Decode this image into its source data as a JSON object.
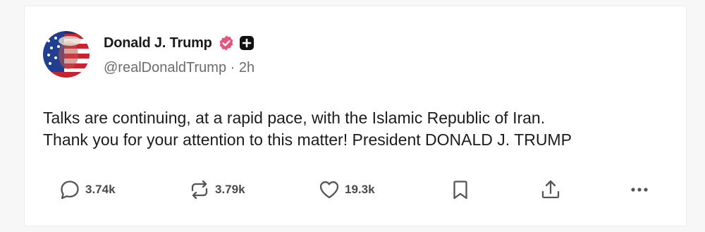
{
  "post": {
    "author_name": "Donald J. Trump",
    "handle": "@realDonaldTrump",
    "separator": " · ",
    "time": "2h",
    "text_lines": [
      "Talks are continuing, at a rapid pace, with the Islamic Republic of Iran.",
      "Thank you for your attention to this matter! President DONALD J. TRUMP"
    ]
  },
  "actions": {
    "replies": "3.74k",
    "reposts": "3.79k",
    "likes": "19.3k"
  },
  "icons": {
    "verified": "verified-badge-icon",
    "plus": "plus-square-icon",
    "reply": "speech-bubble-icon",
    "repost": "repost-arrows-icon",
    "like": "heart-icon",
    "bookmark": "bookmark-icon",
    "share": "share-upload-icon",
    "more": "more-dots-icon"
  },
  "colors": {
    "badge": "#e8537a",
    "text": "#1c1c1c",
    "muted": "#6b6b6b",
    "icon": "#555555"
  }
}
